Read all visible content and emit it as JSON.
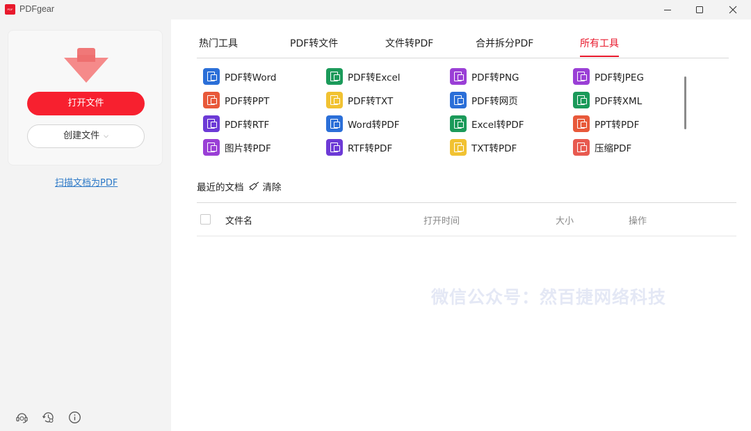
{
  "window": {
    "app_logo_text": "PDF",
    "app_title": "PDFgear"
  },
  "sidebar": {
    "open_button": "打开文件",
    "create_button": "创建文件",
    "scan_link": "扫描文档为PDF",
    "bottom_icons": [
      "support-icon",
      "history-settings-icon",
      "info-icon"
    ]
  },
  "tabs": [
    {
      "label": "热门工具",
      "active": false
    },
    {
      "label": "PDF转文件",
      "active": false
    },
    {
      "label": "文件转PDF",
      "active": false
    },
    {
      "label": "合并拆分PDF",
      "active": false
    },
    {
      "label": "所有工具",
      "active": true
    }
  ],
  "tools": [
    {
      "label": "PDF转Word",
      "color": "#2b6fd8"
    },
    {
      "label": "PDF转Excel",
      "color": "#1b9a5a"
    },
    {
      "label": "PDF转PNG",
      "color": "#9a3fd6"
    },
    {
      "label": "PDF转JPEG",
      "color": "#9a3fd6"
    },
    {
      "label": "PDF转PPT",
      "color": "#e8593a"
    },
    {
      "label": "PDF转TXT",
      "color": "#f1c232"
    },
    {
      "label": "PDF转网页",
      "color": "#2b6fd8"
    },
    {
      "label": "PDF转XML",
      "color": "#1b9a5a"
    },
    {
      "label": "PDF转RTF",
      "color": "#6d3ad6"
    },
    {
      "label": "Word转PDF",
      "color": "#2b6fd8"
    },
    {
      "label": "Excel转PDF",
      "color": "#1b9a5a"
    },
    {
      "label": "PPT转PDF",
      "color": "#e8593a"
    },
    {
      "label": "图片转PDF",
      "color": "#9a3fd6"
    },
    {
      "label": "RTF转PDF",
      "color": "#6d3ad6"
    },
    {
      "label": "TXT转PDF",
      "color": "#f1c232"
    },
    {
      "label": "压缩PDF",
      "color": "#e85a50"
    }
  ],
  "recent": {
    "title": "最近的文档",
    "clear_label": "清除",
    "columns": {
      "name": "文件名",
      "open_time": "打开时间",
      "size": "大小",
      "actions": "操作"
    }
  },
  "watermark": "微信公众号：然百捷网络科技",
  "colors": {
    "accent": "#e8192c",
    "open_button": "#f7202f",
    "link": "#2d79c7"
  }
}
